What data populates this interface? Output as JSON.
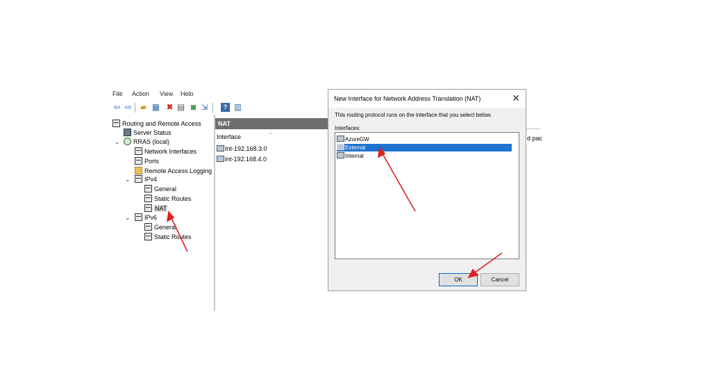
{
  "menu": {
    "items": [
      "File",
      "Action",
      "View",
      "Help"
    ]
  },
  "toolbar": {
    "icons": [
      "back-icon",
      "forward-icon",
      "up-folder-icon",
      "show-hide-tree-icon",
      "delete-icon",
      "properties-icon",
      "refresh-icon",
      "export-icon",
      "help-icon",
      "view-icon"
    ]
  },
  "tree": {
    "root": "Routing and Remote Access",
    "server_status": "Server Status",
    "rras": "RRAS (local)",
    "network_interfaces": "Network Interfaces",
    "ports": "Ports",
    "remote_access_logging": "Remote Access Logging",
    "ipv4": "IPv4",
    "ipv4_general": "General",
    "ipv4_static_routes": "Static Routes",
    "ipv4_nat": "NAT",
    "ipv6": "IPv6",
    "ipv6_general": "General",
    "ipv6_static_routes": "Static Routes"
  },
  "nat_pane": {
    "title": "NAT",
    "column_interface": "Interface",
    "rows": [
      "Int-192.168.3.0",
      "int-192.168.4.0"
    ],
    "clipped_text": "d pac"
  },
  "dialog": {
    "title": "New Interface for Network Address Translation (NAT)",
    "close": "✕",
    "message": "This routing protocol runs on the interface that you select below.",
    "interfaces_label": "Interfaces:",
    "interfaces": [
      "AzureGW",
      "External",
      "Internal"
    ],
    "selected": "External",
    "ok_label": "OK",
    "cancel_label": "Cancel"
  },
  "colors": {
    "selection": "#1e73d2",
    "arrow": "#e02020",
    "header": "#6e6e6e"
  }
}
